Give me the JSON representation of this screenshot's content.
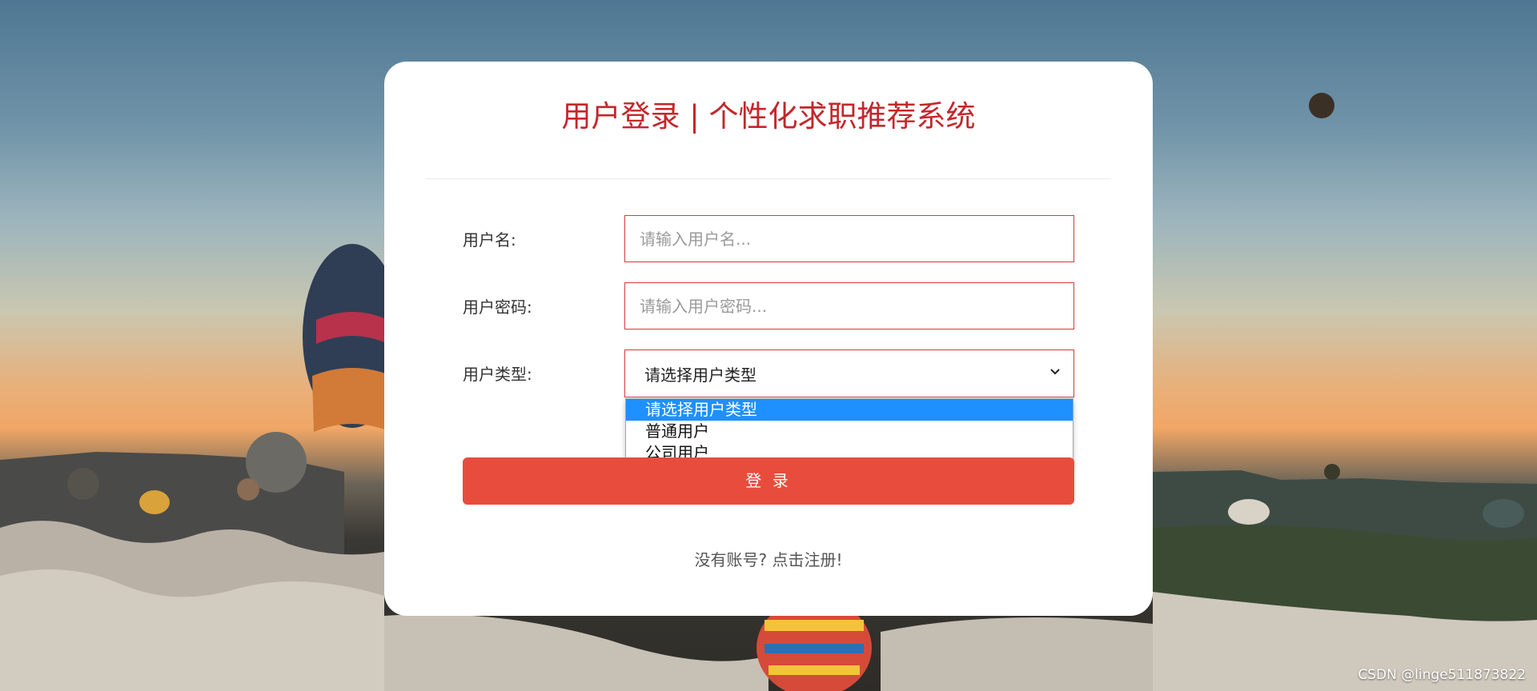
{
  "card": {
    "title": "用户登录 | 个性化求职推荐系统"
  },
  "form": {
    "username_label": "用户名:",
    "username_placeholder": "请输入用户名...",
    "password_label": "用户密码:",
    "password_placeholder": "请输入用户密码...",
    "usertype_label": "用户类型:",
    "usertype_selected": "请选择用户类型",
    "usertype_options": [
      "请选择用户类型",
      "普通用户",
      "公司用户"
    ],
    "login_label": "登 录",
    "register_text": "没有账号? 点击注册!"
  },
  "watermark": "CSDN @linge511873822",
  "icons": {
    "select_arrow": "chevron-down-icon"
  }
}
